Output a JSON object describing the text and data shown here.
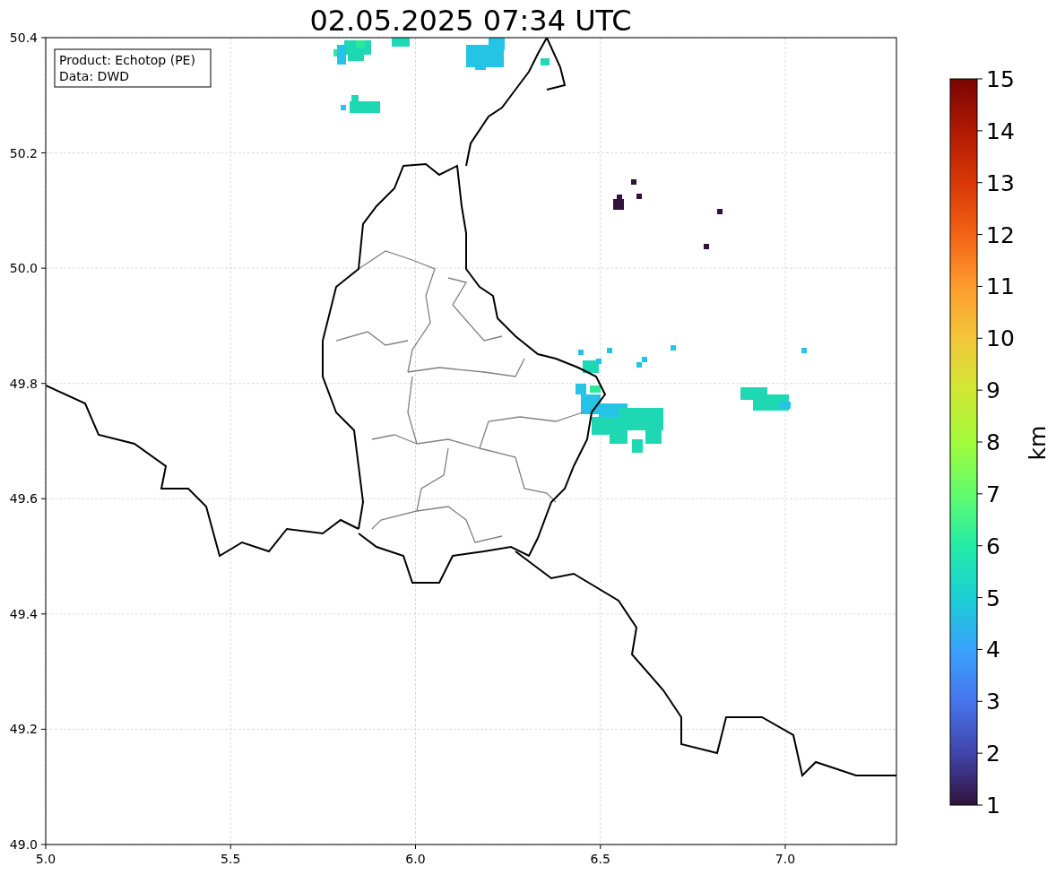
{
  "title": "02.05.2025 07:34 UTC",
  "info_box": [
    "Product: Echotop (PE)",
    "Data: DWD"
  ],
  "x_ticks": [
    "5.0",
    "5.5",
    "6.0",
    "6.5",
    "7.0"
  ],
  "y_ticks": [
    "50.4",
    "50.2",
    "50.0",
    "49.8",
    "49.6",
    "49.4",
    "49.2",
    "49.0"
  ],
  "colorbar": {
    "label": "km",
    "ticks": [
      "15",
      "14",
      "13",
      "12",
      "11",
      "10",
      "9",
      "8",
      "7",
      "6",
      "5",
      "4",
      "3",
      "2",
      "1"
    ]
  }
}
